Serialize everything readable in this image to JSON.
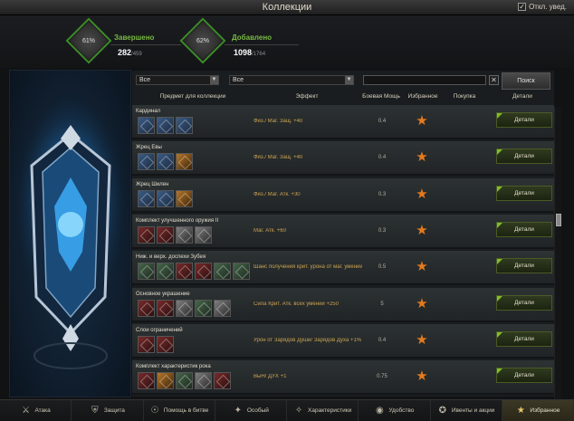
{
  "window": {
    "title": "Коллекции",
    "notif_label": "Откл. увед.",
    "notif_checked": "✓"
  },
  "stats": [
    {
      "label": "Завершено",
      "percent": "61%",
      "value": "282",
      "total": "/459"
    },
    {
      "label": "Добавлено",
      "percent": "62%",
      "value": "1098",
      "total": "/1764"
    }
  ],
  "filters": {
    "filter1": "Все",
    "filter2": "Все",
    "search_value": "",
    "clear": "✕",
    "search_button": "Поиск"
  },
  "columns": {
    "item": "Предмет для коллекции",
    "effect": "Эффект",
    "power": "Боевая Мощь",
    "favorite": "Избранное",
    "purchase": "Покупка",
    "details": "Детали"
  },
  "rows": [
    {
      "name": "Кардинал",
      "effect": "Физ./ Маг. Защ. +40",
      "power": "0.4",
      "details": "Детали",
      "icons": [
        "b",
        "b",
        "b"
      ]
    },
    {
      "name": "Жрец Евы",
      "effect": "Физ./ Маг. Защ. +40",
      "power": "0.4",
      "details": "Детали",
      "icons": [
        "b",
        "b",
        "o"
      ]
    },
    {
      "name": "Жрец Шилен",
      "effect": "Физ./ Маг. Атк. +30",
      "power": "0.3",
      "details": "Детали",
      "icons": [
        "b",
        "b",
        "o"
      ]
    },
    {
      "name": "Комплект улучшенного оружия II",
      "effect": "Маг. Атк. +60",
      "power": "0.3",
      "details": "Детали",
      "icons": [
        "r",
        "r",
        "w",
        "w"
      ]
    },
    {
      "name": "Ниж. и верх. доспехи Зубея",
      "effect": "Шанс получения крит. урона от маг. умений -1%",
      "power": "0.5",
      "details": "Детали",
      "icons": [
        "g",
        "g",
        "r",
        "r",
        "g",
        "g"
      ]
    },
    {
      "name": "Основное украшение",
      "effect": "Сила Крит. Атк. всех умений +250",
      "power": "5",
      "details": "Детали",
      "icons": [
        "r",
        "r",
        "w",
        "g",
        "w"
      ]
    },
    {
      "name": "Слои ограничений",
      "effect": "Урон от Зарядов Души/ Зарядов Духа +1%",
      "power": "0.4",
      "details": "Детали",
      "icons": [
        "r",
        "r"
      ]
    },
    {
      "name": "Комплект характеристик рока",
      "effect": "ВыН/ ДУХ +1",
      "power": "0.75",
      "details": "Детали",
      "icons": [
        "r",
        "o",
        "g",
        "w",
        "r"
      ]
    }
  ],
  "bottom_tabs": [
    {
      "label": "Атака",
      "icon": "crossed-swords-icon"
    },
    {
      "label": "Защита",
      "icon": "shield-icon"
    },
    {
      "label": "Помощь в битве",
      "icon": "helping-hand-icon"
    },
    {
      "label": "Особый",
      "icon": "sparkle-icon"
    },
    {
      "label": "Характеристики",
      "icon": "stats-icon"
    },
    {
      "label": "Удобство",
      "icon": "comfort-icon"
    },
    {
      "label": "Ивенты и акции",
      "icon": "event-icon"
    },
    {
      "label": "Избранное",
      "icon": "star-icon"
    }
  ],
  "colors": {
    "accent_green": "#79b843",
    "star": "#e57a1c",
    "effect_text": "#c9a352"
  }
}
